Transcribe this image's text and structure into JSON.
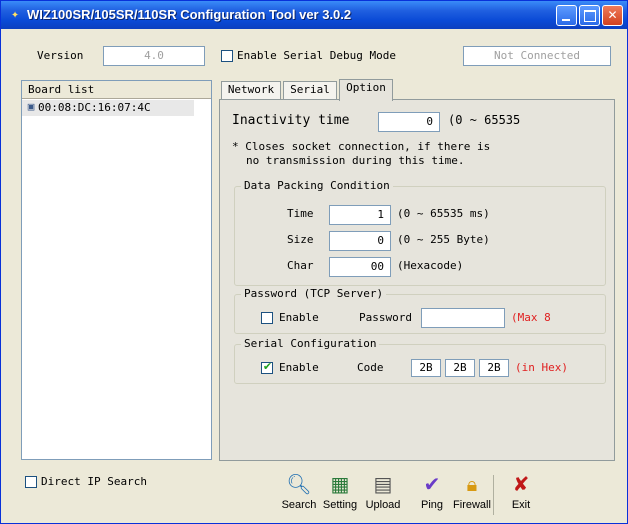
{
  "window": {
    "title": "WIZ100SR/105SR/110SR Configuration Tool ver 3.0.2"
  },
  "version": {
    "label": "Version",
    "value": "4.0"
  },
  "serial_debug": {
    "label": "Enable Serial Debug Mode",
    "checked": false
  },
  "connection_status": "Not Connected",
  "board_list": {
    "header": "Board list",
    "items": [
      "00:08:DC:16:07:4C"
    ]
  },
  "tabs": {
    "items": [
      "Network",
      "Serial",
      "Option"
    ],
    "active": "Option"
  },
  "option": {
    "inactivity": {
      "label": "Inactivity time",
      "value": "0",
      "range": "(0 ~ 65535"
    },
    "note_line1": "* Closes socket connection, if there is",
    "note_line2": "no transmission during this time.",
    "data_packing": {
      "title": "Data Packing Condition",
      "time": {
        "label": "Time",
        "value": "1",
        "hint": "(0 ~ 65535 ms)"
      },
      "size": {
        "label": "Size",
        "value": "0",
        "hint": "(0 ~ 255 Byte)"
      },
      "char": {
        "label": "Char",
        "value": "00",
        "hint": "(Hexacode)"
      }
    },
    "password": {
      "title": "Password (TCP Server)",
      "enable_label": "Enable",
      "enabled": false,
      "password_label": "Password",
      "password_value": "",
      "max_hint": "(Max 8"
    },
    "serial_config": {
      "title": "Serial Configuration",
      "enable_label": "Enable",
      "enabled": true,
      "code_label": "Code",
      "codes": [
        "2B",
        "2B",
        "2B"
      ],
      "hex_hint": "(in Hex)"
    }
  },
  "direct_ip_search": {
    "label": "Direct IP Search",
    "checked": false
  },
  "toolbar": {
    "search": "Search",
    "setting": "Setting",
    "upload": "Upload",
    "ping": "Ping",
    "firewall": "Firewall",
    "exit": "Exit"
  },
  "icons": {
    "titlebar": "app-icon",
    "search": "search-magnifier-icon",
    "setting": "settings-board-icon",
    "upload": "document-upload-icon",
    "ping": "ping-check-icon",
    "firewall": "firewall-lock-icon",
    "exit": "exit-x-icon"
  }
}
